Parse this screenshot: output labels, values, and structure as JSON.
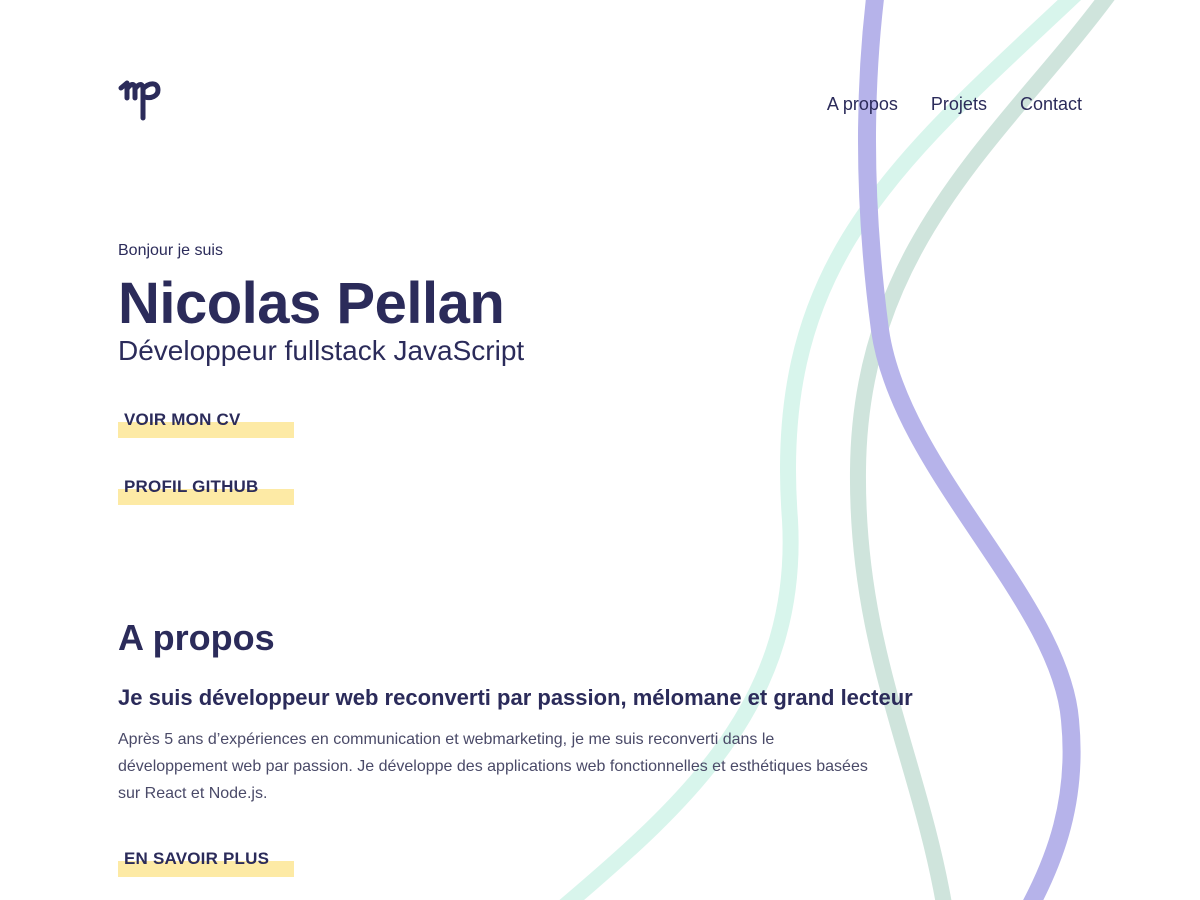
{
  "colors": {
    "text": "#2b2b5a",
    "highlight": "#fdeaa5",
    "wave_purple": "#b6b3ea",
    "wave_mint": "#d8f5ec",
    "wave_sage": "#cfe4dc"
  },
  "header": {
    "logo_icon": "np-monogram-icon",
    "nav": [
      {
        "label": "A propos"
      },
      {
        "label": "Projets"
      },
      {
        "label": "Contact"
      }
    ]
  },
  "hero": {
    "greeting": "Bonjour je suis",
    "name": "Nicolas Pellan",
    "role": "Développeur fullstack JavaScript",
    "buttons": [
      {
        "label": "VOIR MON CV"
      },
      {
        "label": "PROFIL GITHUB"
      }
    ]
  },
  "about": {
    "title": "A propos",
    "subtitle": "Je suis développeur web reconverti par passion, mélomane et grand lecteur",
    "text": "Après 5 ans d’expériences en communication et webmarketing, je me suis reconverti dans le développement web par passion. Je développe des applications web fonctionnelles et esthétiques basées sur React et Node.js.",
    "button_label": "EN SAVOIR PLUS"
  }
}
